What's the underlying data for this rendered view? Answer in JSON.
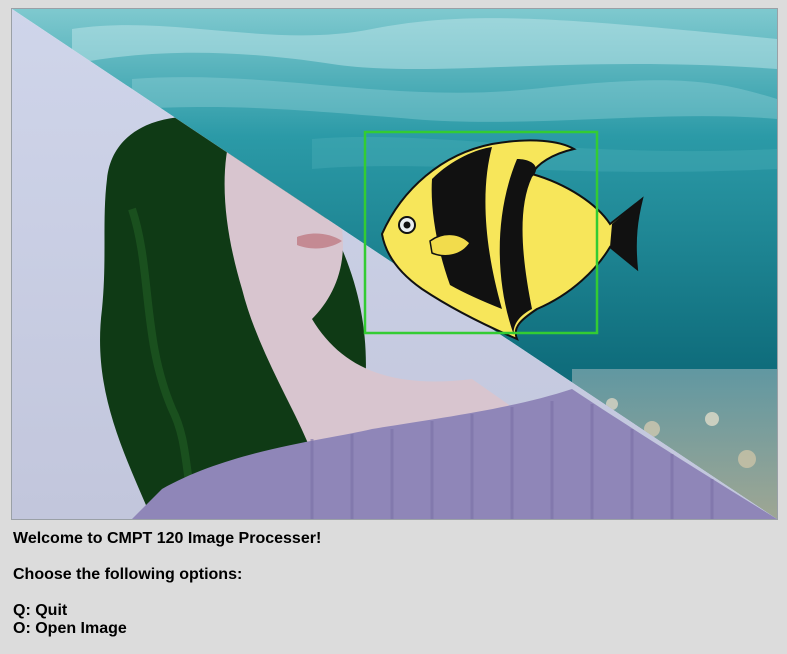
{
  "canvas": {
    "scene": "underwater-and-portrait-composite",
    "detection_box_color": "#33cc33",
    "fish_colors": {
      "body": "#f7e65a",
      "stripe": "#111111"
    },
    "water_colors": [
      "#0f6d7c",
      "#2b9aa7",
      "#86c9cf"
    ],
    "portrait_colors": {
      "background": "#c9d0e6",
      "sweater": "#8f86b8",
      "hair": "#0f3a15",
      "skin": "#d8c5cf"
    }
  },
  "messages": {
    "welcome": "Welcome to CMPT 120 Image Processer!",
    "choose": "Choose the following options:",
    "options": [
      "Q: Quit",
      "O: Open Image"
    ]
  }
}
